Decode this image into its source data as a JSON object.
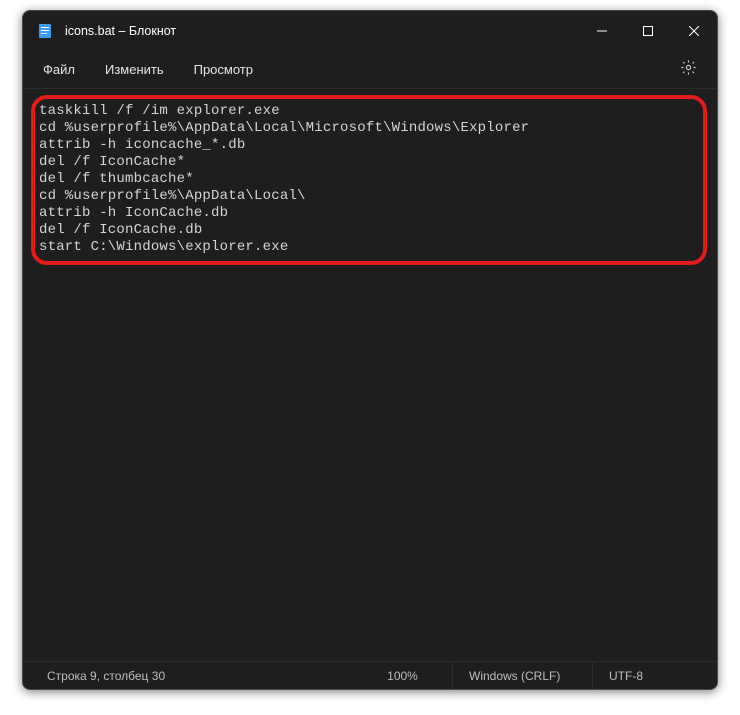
{
  "titlebar": {
    "title": "icons.bat – Блокнот",
    "app_icon": "notepad-icon"
  },
  "menu": {
    "file": "Файл",
    "edit": "Изменить",
    "view": "Просмотр"
  },
  "editor": {
    "lines": [
      "taskkill /f /im explorer.exe",
      "cd %userprofile%\\AppData\\Local\\Microsoft\\Windows\\Explorer",
      "attrib -h iconcache_*.db",
      "del /f IconCache*",
      "del /f thumbcache*",
      "cd %userprofile%\\AppData\\Local\\",
      "attrib -h IconCache.db",
      "del /f IconCache.db",
      "start C:\\Windows\\explorer.exe"
    ]
  },
  "status": {
    "cursor": "Строка 9, столбец 30",
    "zoom": "100%",
    "eol": "Windows (CRLF)",
    "encoding": "UTF-8"
  },
  "highlight": {
    "color": "#e31b1b"
  }
}
